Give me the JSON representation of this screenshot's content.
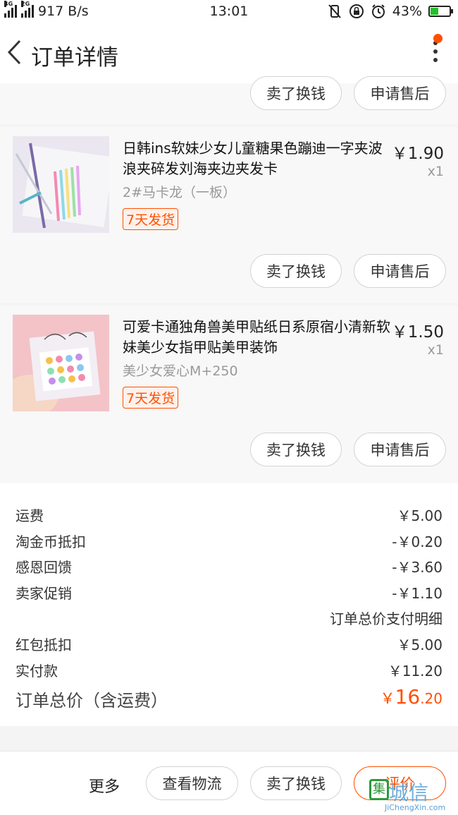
{
  "status_bar": {
    "network_tag_1": "4G",
    "network_tag_2": "2G",
    "speed": "917 B/s",
    "time": "13:01",
    "battery": "43%",
    "battery_level": 0.43
  },
  "header": {
    "title": "订单详情"
  },
  "items": [
    {
      "name": "日韩ins软妹少女儿童糖果色蹦迪一字夹波浪夹碎发刘海夹边夹发卡",
      "price": "￥1.90",
      "qty": "x1",
      "sku": "2#马卡龙（一板）",
      "badge": "7天发货"
    },
    {
      "name": "可爱卡通独角兽美甲贴纸日系原宿小清新软妹美少女指甲贴美甲装饰",
      "price": "￥1.50",
      "qty": "x1",
      "sku": "美少女爱心M+250",
      "badge": "7天发货"
    }
  ],
  "item_actions": {
    "sell": "卖了换钱",
    "after_sales": "申请售后"
  },
  "fees": {
    "shipping": {
      "label": "运费",
      "value": "￥5.00"
    },
    "coins": {
      "label": "淘金币抵扣",
      "value": "-￥0.20"
    },
    "thanks": {
      "label": "感恩回馈",
      "value": "-￥3.60"
    },
    "promo": {
      "label": "卖家促销",
      "value": "-￥1.10"
    },
    "detail_link": "订单总价支付明细",
    "redpacket": {
      "label": "红包抵扣",
      "value": "￥5.00"
    },
    "paid": {
      "label": "实付款",
      "value": "￥11.20"
    },
    "total": {
      "label": "订单总价（含运费）",
      "currency": "￥",
      "int": "16",
      "dec": ".20"
    }
  },
  "bottom_bar": {
    "more": "更多",
    "logistics": "查看物流",
    "sell": "卖了换钱",
    "review": "评价"
  },
  "watermark": {
    "main": "城信",
    "logo": "集",
    "sub": "JiChengXin.com"
  },
  "colors": {
    "accent": "#ff5000",
    "watermark": "#5aa0d6"
  }
}
